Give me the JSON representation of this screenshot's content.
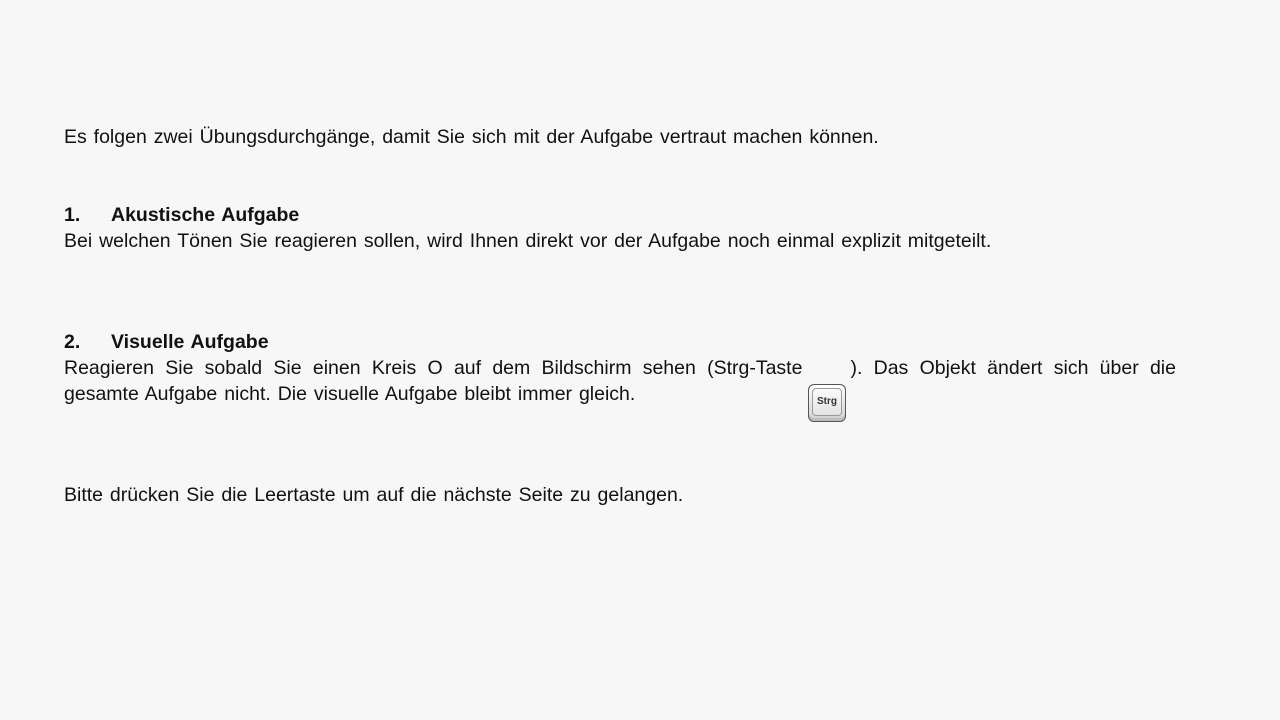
{
  "intro": "Es folgen zwei Übungsdurchgänge, damit Sie sich mit der Aufgabe vertraut machen können.",
  "sections": [
    {
      "number": "1.",
      "title": "Akustische Aufgabe",
      "text": "Bei welchen Tönen Sie reagieren sollen, wird Ihnen direkt vor der Aufgabe noch einmal explizit mitgeteilt."
    },
    {
      "number": "2.",
      "title": "Visuelle Aufgabe",
      "text_before_key": "Reagieren Sie sobald Sie einen Kreis O auf dem Bildschirm sehen (Strg-Taste",
      "text_after_key": "). Das Objekt ändert sich über die gesamte Aufgabe nicht. Die visuelle Aufgabe bleibt immer gleich."
    }
  ],
  "key": {
    "label": "Strg",
    "icon": "strg-key-icon"
  },
  "outro": "Bitte drücken Sie die Leertaste um auf die nächste Seite zu gelangen."
}
